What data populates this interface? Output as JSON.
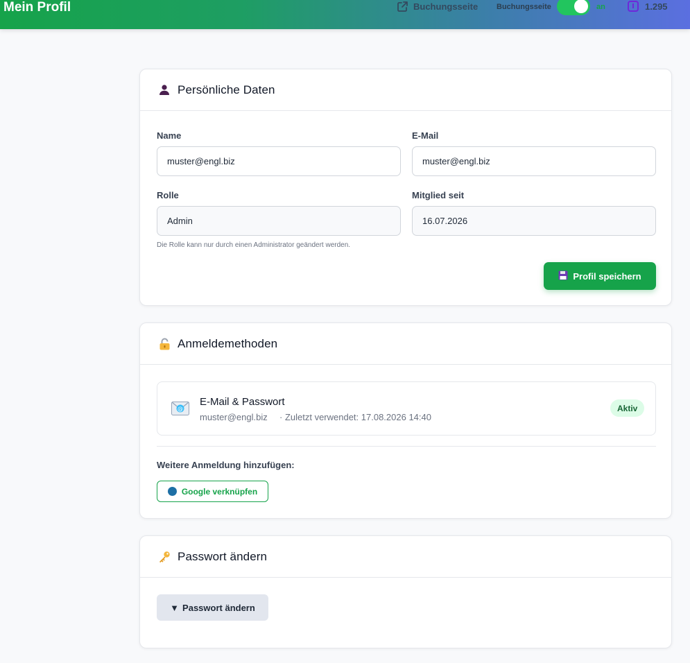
{
  "header": {
    "title": "Mein Profil",
    "booking_link_label": "Buchungsseite",
    "toggle_label": "Buchungsseite",
    "toggle_state": "an",
    "credits": "1.295"
  },
  "personal": {
    "title": "Persönliche Daten",
    "name_label": "Name",
    "name_value": "muster@engl.biz",
    "email_label": "E-Mail",
    "email_value": "muster@engl.biz",
    "role_label": "Rolle",
    "role_value": "Admin",
    "member_label": "Mitglied seit",
    "member_value": "16.07.2026",
    "role_hint": "Die Rolle kann nur durch einen Administrator geändert werden.",
    "save_label": "Profil speichern"
  },
  "login_methods": {
    "title": "Anmeldemethoden",
    "method_title": "E-Mail & Passwort",
    "method_email": "muster@engl.biz",
    "method_last_used": "· Zuletzt verwendet: 17.08.2026 14:40",
    "status_badge": "Aktiv",
    "add_label": "Weitere Anmeldung hinzufügen:",
    "google_label": "Google verknüpfen"
  },
  "password": {
    "title": "Passwort ändern",
    "toggle_label": "Passwort ändern",
    "toggle_glyph": "▼"
  },
  "colors": {
    "accent": "#16a34a",
    "badge_bg": "#dcfce7",
    "google_dot": "#1d6fa5"
  }
}
